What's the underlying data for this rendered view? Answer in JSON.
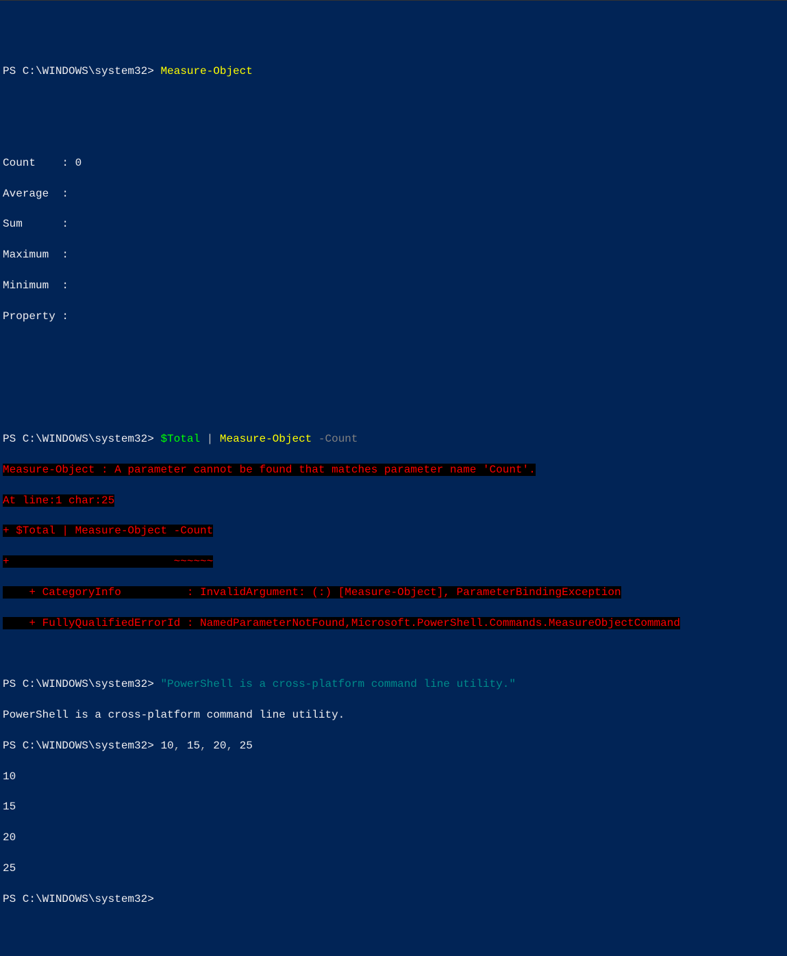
{
  "prompt": "PS C:\\WINDOWS\\system32> ",
  "cmd1": {
    "cmdlet": "Measure-Object"
  },
  "out1": {
    "count_label": "Count    : ",
    "count_val": "0",
    "avg": "Average  :",
    "sum": "Sum      :",
    "max": "Maximum  :",
    "min": "Minimum  :",
    "prop": "Property :"
  },
  "cmd2": {
    "var": "$Total",
    "pipe": " | ",
    "cmdlet": "Measure-Object",
    "sp": " ",
    "param": "-Count"
  },
  "err": {
    "l1": "Measure-Object : A parameter cannot be found that matches parameter name 'Count'.",
    "l2": "At line:1 char:25",
    "l3": "+ $Total | Measure-Object -Count",
    "l4a": "+                         ",
    "l4b": "~~~~~~",
    "l5": "    + CategoryInfo          : InvalidArgument: (:) [Measure-Object], ParameterBindingException",
    "l6": "    + FullyQualifiedErrorId : NamedParameterNotFound,Microsoft.PowerShell.Commands.MeasureObjectCommand"
  },
  "cmd3": {
    "str": "\"PowerShell is a cross-platform command line utility.\""
  },
  "out3": "PowerShell is a cross-platform command line utility.",
  "cmd4": {
    "n1": "10",
    "c": ", ",
    "n2": "15",
    "n3": "20",
    "n4": "25"
  },
  "out4": {
    "l1": "10",
    "l2": "15",
    "l3": "20",
    "l4": "25"
  }
}
